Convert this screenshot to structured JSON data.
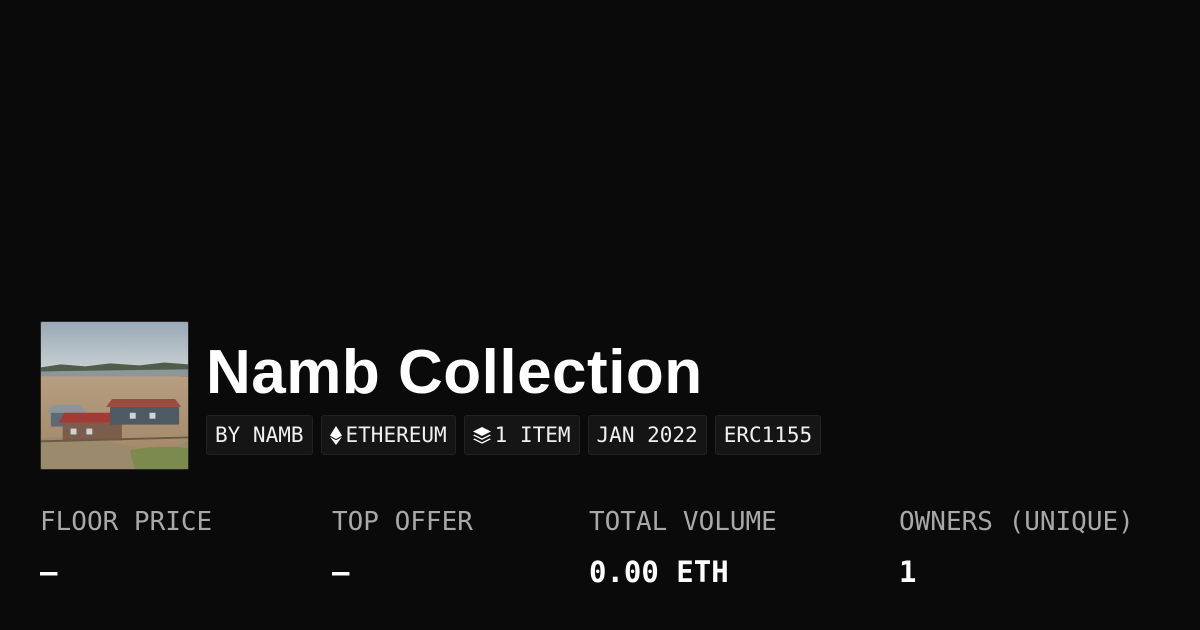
{
  "collection": {
    "name": "Namb Collection",
    "avatar_icon": "collection-thumbnail-photo"
  },
  "tags": {
    "creator": "BY NAMB",
    "chain": "ETHEREUM",
    "chain_icon": "ethereum-icon",
    "items": "1 ITEM",
    "items_icon": "layers-icon",
    "date": "JAN 2022",
    "standard": "ERC1155"
  },
  "stats": {
    "floor_price": {
      "label": "FLOOR PRICE",
      "value": "—"
    },
    "top_offer": {
      "label": "TOP OFFER",
      "value": "—"
    },
    "total_volume": {
      "label": "TOTAL VOLUME",
      "value": "0.00 ETH"
    },
    "owners": {
      "label": "OWNERS (UNIQUE)",
      "value": "1"
    }
  },
  "colors": {
    "background": "#0a0a0a",
    "text": "#ffffff",
    "muted": "#a8a8a8",
    "tag_bg": "#151515"
  }
}
